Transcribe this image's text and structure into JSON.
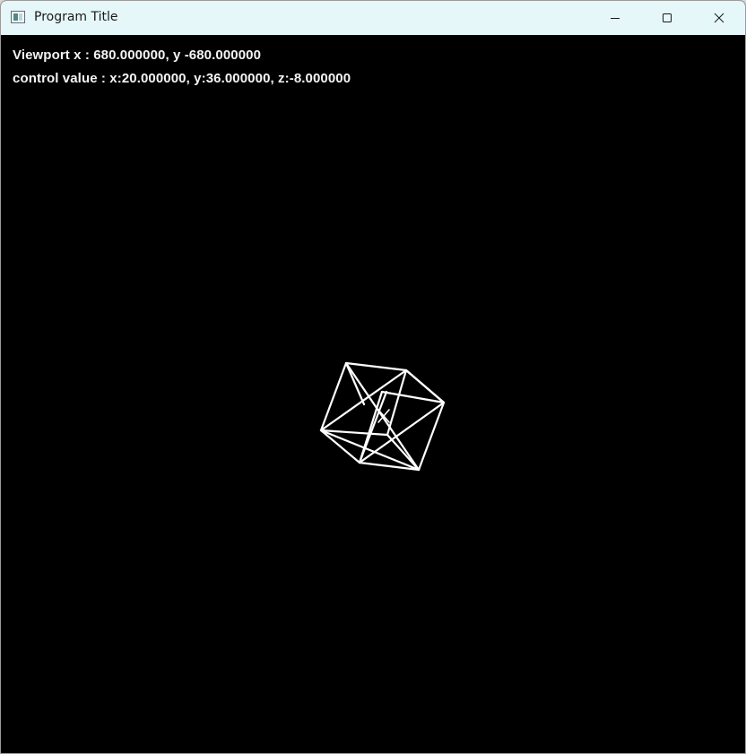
{
  "window": {
    "title": "Program Title",
    "icon": "app-window-icon",
    "controls": {
      "minimize_icon": "minimize-icon",
      "maximize_icon": "maximize-icon",
      "close_icon": "close-icon"
    }
  },
  "overlay": {
    "viewport_text": "Viewport x : 680.000000, y -680.000000",
    "control_text": "control value : x:20.000000, y:36.000000, z:-8.000000"
  },
  "colors": {
    "titlebar": "#e6f7f9",
    "client_background": "#000000",
    "wireframe": "#ffffff",
    "overlay_text": "#f4f4f4"
  }
}
